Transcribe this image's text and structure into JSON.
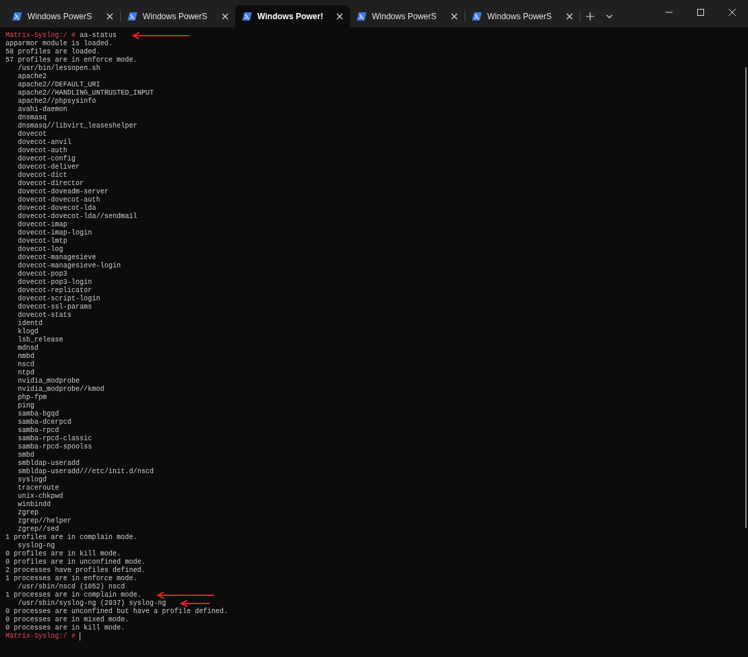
{
  "tabs": [
    {
      "title": "Windows PowerS",
      "selected": false
    },
    {
      "title": "Windows PowerS",
      "selected": false
    },
    {
      "title": "Windows Power!",
      "selected": true
    },
    {
      "title": "Windows PowerS",
      "selected": false
    },
    {
      "title": "Windows PowerS",
      "selected": false
    }
  ],
  "terminal": {
    "lines": [
      {
        "kind": "prompt",
        "prompt": "Matrix-Syslog:/ #",
        "command": "aa-status",
        "arrow": true
      },
      {
        "kind": "output",
        "text": "apparmor module is loaded."
      },
      {
        "kind": "output",
        "text": "58 profiles are loaded."
      },
      {
        "kind": "output",
        "text": "57 profiles are in enforce mode."
      },
      {
        "kind": "item",
        "text": "/usr/bin/lessopen.sh"
      },
      {
        "kind": "item",
        "text": "apache2"
      },
      {
        "kind": "item",
        "text": "apache2//DEFAULT_URI"
      },
      {
        "kind": "item",
        "text": "apache2//HANDLING_UNTRUSTED_INPUT"
      },
      {
        "kind": "item",
        "text": "apache2//phpsysinfo"
      },
      {
        "kind": "item",
        "text": "avahi-daemon"
      },
      {
        "kind": "item",
        "text": "dnsmasq"
      },
      {
        "kind": "item",
        "text": "dnsmasq//libvirt_leaseshelper"
      },
      {
        "kind": "item",
        "text": "dovecot"
      },
      {
        "kind": "item",
        "text": "dovecot-anvil"
      },
      {
        "kind": "item",
        "text": "dovecot-auth"
      },
      {
        "kind": "item",
        "text": "dovecot-config"
      },
      {
        "kind": "item",
        "text": "dovecot-deliver"
      },
      {
        "kind": "item",
        "text": "dovecot-dict"
      },
      {
        "kind": "item",
        "text": "dovecot-director"
      },
      {
        "kind": "item",
        "text": "dovecot-doveadm-server"
      },
      {
        "kind": "item",
        "text": "dovecot-dovecot-auth"
      },
      {
        "kind": "item",
        "text": "dovecot-dovecot-lda"
      },
      {
        "kind": "item",
        "text": "dovecot-dovecot-lda//sendmail"
      },
      {
        "kind": "item",
        "text": "dovecot-imap"
      },
      {
        "kind": "item",
        "text": "dovecot-imap-login"
      },
      {
        "kind": "item",
        "text": "dovecot-lmtp"
      },
      {
        "kind": "item",
        "text": "dovecot-log"
      },
      {
        "kind": "item",
        "text": "dovecot-managesieve"
      },
      {
        "kind": "item",
        "text": "dovecot-managesieve-login"
      },
      {
        "kind": "item",
        "text": "dovecot-pop3"
      },
      {
        "kind": "item",
        "text": "dovecot-pop3-login"
      },
      {
        "kind": "item",
        "text": "dovecot-replicator"
      },
      {
        "kind": "item",
        "text": "dovecot-script-login"
      },
      {
        "kind": "item",
        "text": "dovecot-ssl-params"
      },
      {
        "kind": "item",
        "text": "dovecot-stats"
      },
      {
        "kind": "item",
        "text": "identd"
      },
      {
        "kind": "item",
        "text": "klogd"
      },
      {
        "kind": "item",
        "text": "lsb_release"
      },
      {
        "kind": "item",
        "text": "mdnsd"
      },
      {
        "kind": "item",
        "text": "nmbd"
      },
      {
        "kind": "item",
        "text": "nscd"
      },
      {
        "kind": "item",
        "text": "ntpd"
      },
      {
        "kind": "item",
        "text": "nvidia_modprobe"
      },
      {
        "kind": "item",
        "text": "nvidia_modprobe//kmod"
      },
      {
        "kind": "item",
        "text": "php-fpm"
      },
      {
        "kind": "item",
        "text": "ping"
      },
      {
        "kind": "item",
        "text": "samba-bgqd"
      },
      {
        "kind": "item",
        "text": "samba-dcerpcd"
      },
      {
        "kind": "item",
        "text": "samba-rpcd"
      },
      {
        "kind": "item",
        "text": "samba-rpcd-classic"
      },
      {
        "kind": "item",
        "text": "samba-rpcd-spoolss"
      },
      {
        "kind": "item",
        "text": "smbd"
      },
      {
        "kind": "item",
        "text": "smbldap-useradd"
      },
      {
        "kind": "item",
        "text": "smbldap-useradd///etc/init.d/nscd"
      },
      {
        "kind": "item",
        "text": "syslogd"
      },
      {
        "kind": "item",
        "text": "traceroute"
      },
      {
        "kind": "item",
        "text": "unix-chkpwd"
      },
      {
        "kind": "item",
        "text": "winbindd"
      },
      {
        "kind": "item",
        "text": "zgrep"
      },
      {
        "kind": "item",
        "text": "zgrep//helper"
      },
      {
        "kind": "item",
        "text": "zgrep//sed"
      },
      {
        "kind": "output",
        "text": "1 profiles are in complain mode."
      },
      {
        "kind": "item",
        "text": "syslog-ng"
      },
      {
        "kind": "output",
        "text": "0 profiles are in kill mode."
      },
      {
        "kind": "output",
        "text": "0 profiles are in unconfined mode."
      },
      {
        "kind": "output",
        "text": "2 processes have profiles defined."
      },
      {
        "kind": "output",
        "text": "1 processes are in enforce mode."
      },
      {
        "kind": "item",
        "text": "/usr/sbin/nscd (1052) nscd"
      },
      {
        "kind": "output",
        "text": "1 processes are in complain mode.",
        "arrow": true
      },
      {
        "kind": "item",
        "text": "/usr/sbin/syslog-ng (2937) syslog-ng",
        "arrow": true
      },
      {
        "kind": "output",
        "text": "0 processes are unconfined but have a profile defined."
      },
      {
        "kind": "output",
        "text": "0 processes are in mixed mode."
      },
      {
        "kind": "output",
        "text": "0 processes are in kill mode."
      },
      {
        "kind": "prompt",
        "prompt": "Matrix-Syslog:/ #",
        "cursor": true
      }
    ]
  }
}
